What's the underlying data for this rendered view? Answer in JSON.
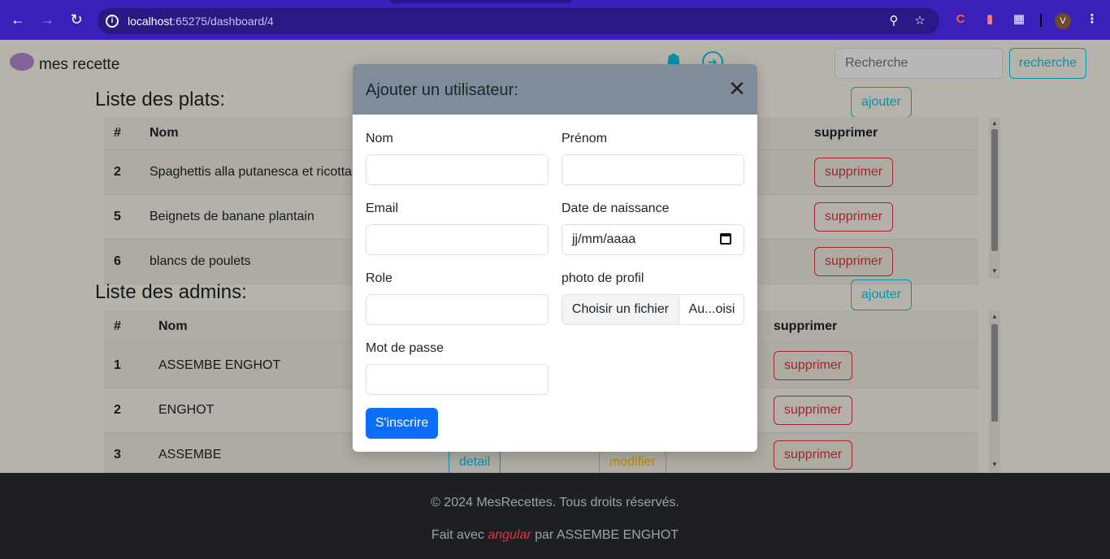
{
  "browser": {
    "url_host": "localhost",
    "url_rest": ":65275/dashboard/4",
    "avatar_letter": "V"
  },
  "nav": {
    "brand": "mes recette",
    "search_placeholder": "Recherche",
    "search_button": "recherche"
  },
  "plats": {
    "title": "Liste des plats:",
    "add_button": "ajouter",
    "headers": {
      "num": "#",
      "nom": "Nom",
      "supprimer": "supprimer"
    },
    "rows": [
      {
        "id": "2",
        "nom": "Spaghettis alla putanesca et ricotta",
        "delete": "supprimer"
      },
      {
        "id": "5",
        "nom": "Beignets de banane plantain",
        "delete": "supprimer"
      },
      {
        "id": "6",
        "nom": "blancs de poulets",
        "delete": "supprimer"
      }
    ]
  },
  "admins": {
    "title": "Liste des admins:",
    "add_button": "ajouter",
    "headers": {
      "num": "#",
      "nom": "Nom",
      "supprimer": "supprimer"
    },
    "rows": [
      {
        "id": "1",
        "nom": "ASSEMBE ENGHOT",
        "delete": "supprimer"
      },
      {
        "id": "2",
        "nom": "ENGHOT",
        "delete": "supprimer"
      },
      {
        "id": "3",
        "nom": "ASSEMBE",
        "detail": "detail",
        "modifier": "modifier",
        "delete": "supprimer"
      }
    ]
  },
  "modal": {
    "title": "Ajouter un utilisateur:",
    "labels": {
      "nom": "Nom",
      "prenom": "Prénom",
      "email": "Email",
      "date": "Date de naissance",
      "role": "Role",
      "photo": "photo de profil",
      "password": "Mot de passe"
    },
    "date_placeholder": "jj/mm/aaaa",
    "file_button": "Choisir un fichier",
    "file_name": "Au...oisi",
    "submit": "S'inscrire"
  },
  "footer": {
    "copyright": "© 2024 MesRecettes. Tous droits réservés.",
    "made_prefix": "Fait avec",
    "made_tech": "angular",
    "made_suffix": "par ASSEMBE ENGHOT"
  },
  "colors": {
    "browser_bar": "#3a1fb8",
    "accent_info": "#0dcaf0",
    "danger": "#dc3545",
    "primary": "#0d6efd"
  }
}
